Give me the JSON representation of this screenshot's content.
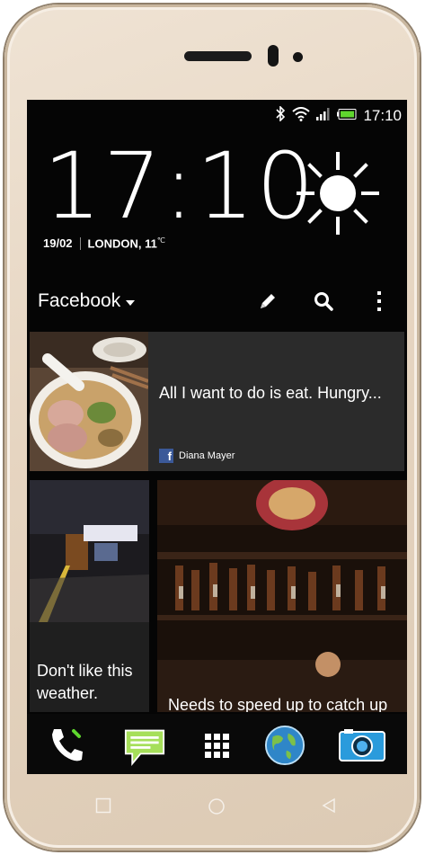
{
  "status_bar": {
    "time": "17:10",
    "icons": [
      "bluetooth-icon",
      "wifi-icon",
      "signal-icon",
      "battery-icon"
    ]
  },
  "clock_widget": {
    "time": "17:10",
    "date": "19/02",
    "location": "LONDON, 11",
    "temp_unit": "℃",
    "weather_icon": "sun-icon"
  },
  "feed": {
    "title": "Facebook",
    "actions": [
      "edit-icon",
      "search-icon",
      "overflow-menu-icon"
    ],
    "posts": [
      {
        "text": "All I want to do is eat. Hungry...",
        "author": "Diana Mayer",
        "source_icon": "facebook-icon"
      },
      {
        "text_line1": "Don't like this",
        "text_line2": "weather."
      },
      {
        "text": "Needs to speed up to catch up"
      }
    ]
  },
  "dock": {
    "apps": [
      "phone-icon",
      "messages-icon",
      "app-drawer-icon",
      "browser-globe-icon",
      "camera-icon"
    ]
  },
  "colors": {
    "body": "#e6d5c1",
    "screen": "#050505",
    "facebook": "#3b5998",
    "battery": "#5fd62e"
  }
}
